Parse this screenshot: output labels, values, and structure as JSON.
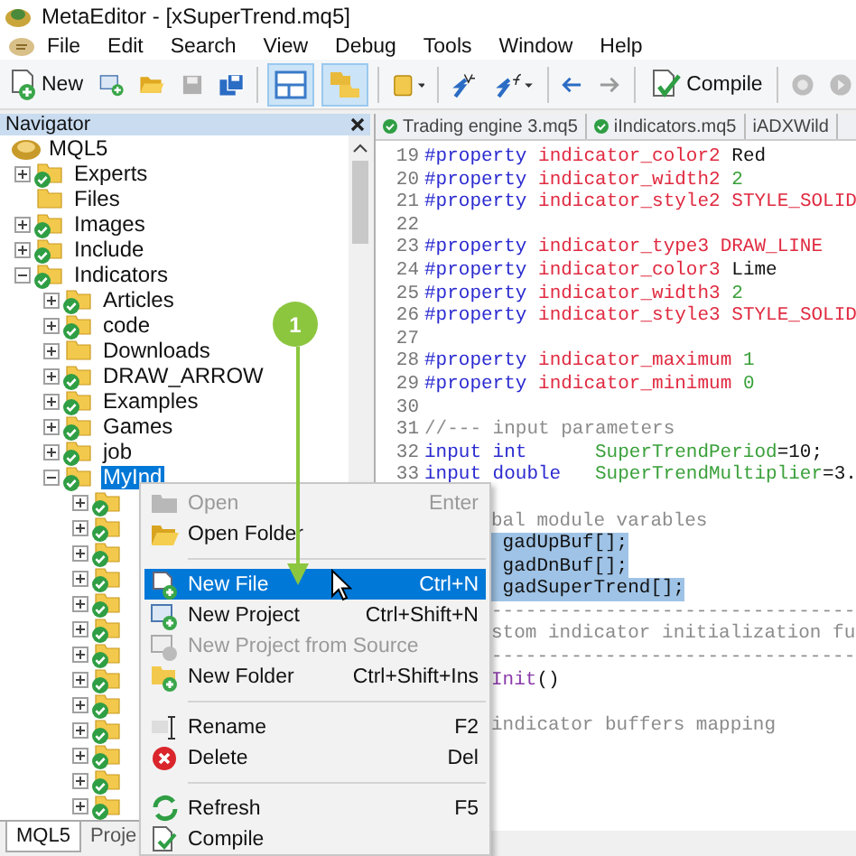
{
  "window": {
    "title": "MetaEditor - [xSuperTrend.mq5]"
  },
  "menu": [
    "File",
    "Edit",
    "Search",
    "View",
    "Debug",
    "Tools",
    "Window",
    "Help"
  ],
  "toolbar": {
    "new_button": {
      "label": "New"
    },
    "compile_button": {
      "label": "Compile"
    },
    "save_disabled": true,
    "view_toggles": [
      {
        "pressed": true
      },
      {
        "pressed": true
      }
    ]
  },
  "navigator": {
    "title": "Navigator",
    "root": {
      "label": "MQL5",
      "selected": false,
      "children": [
        {
          "label": "Experts",
          "selected": false,
          "expanded": false,
          "synced": true
        },
        {
          "label": "Files",
          "selected": false,
          "synced": false
        },
        {
          "label": "Images",
          "selected": false,
          "expanded": false,
          "synced": true
        },
        {
          "label": "Include",
          "selected": false,
          "expanded": false,
          "synced": true
        },
        {
          "label": "Indicators",
          "selected": false,
          "expanded": true,
          "synced": true,
          "children": [
            {
              "label": "Articles",
              "selected": false,
              "expanded": false,
              "synced": true
            },
            {
              "label": "code",
              "selected": false,
              "expanded": false,
              "synced": true
            },
            {
              "label": "Downloads",
              "selected": false,
              "expanded": false,
              "synced": false
            },
            {
              "label": "DRAW_ARROW",
              "selected": false,
              "expanded": false,
              "synced": true
            },
            {
              "label": "Examples",
              "selected": false,
              "expanded": false,
              "synced": true
            },
            {
              "label": "Games",
              "selected": false,
              "expanded": false,
              "synced": true
            },
            {
              "label": "job",
              "selected": false,
              "expanded": false,
              "synced": true
            },
            {
              "label": "MyInd",
              "selected": true,
              "expanded": true,
              "synced": true,
              "children": [
                {
                  "expanded": false,
                  "synced": true
                },
                {
                  "expanded": false,
                  "synced": true
                },
                {
                  "expanded": false,
                  "synced": true
                },
                {
                  "expanded": false,
                  "synced": true
                },
                {
                  "expanded": false,
                  "synced": true
                },
                {
                  "expanded": false,
                  "synced": true
                },
                {
                  "expanded": false,
                  "synced": true
                },
                {
                  "expanded": false,
                  "synced": true
                },
                {
                  "expanded": false,
                  "synced": true
                },
                {
                  "expanded": false,
                  "synced": true
                },
                {
                  "expanded": false,
                  "synced": true
                },
                {
                  "expanded": false,
                  "synced": true
                },
                {
                  "expanded": false,
                  "synced": true
                }
              ]
            }
          ]
        }
      ]
    }
  },
  "bottom_tabs": [
    {
      "label": "MQL5",
      "selected": true
    },
    {
      "label": "Proje",
      "selected": false
    }
  ],
  "editor_tabs": [
    {
      "label": "Trading engine 3.mq5",
      "synced": true
    },
    {
      "label": "iIndicators.mq5",
      "synced": true
    },
    {
      "label": "iADXWild",
      "synced": false
    }
  ],
  "code_lines": [
    {
      "kind": "full",
      "num": "19",
      "selected": false,
      "tokens": [
        {
          "text": "#property",
          "kind": "directive"
        },
        {
          "text": "indicator_color2",
          "kind": "property"
        },
        {
          "text": "Red",
          "kind": "plain"
        }
      ]
    },
    {
      "kind": "full",
      "num": "20",
      "selected": false,
      "tokens": [
        {
          "text": "#property",
          "kind": "directive"
        },
        {
          "text": "indicator_width2",
          "kind": "property"
        },
        {
          "text": "2",
          "kind": "number"
        }
      ]
    },
    {
      "kind": "full",
      "num": "21",
      "selected": false,
      "tokens": [
        {
          "text": "#property",
          "kind": "directive"
        },
        {
          "text": "indicator_style2",
          "kind": "property"
        },
        {
          "text": "STYLE_SOLID",
          "kind": "constant"
        }
      ]
    },
    {
      "kind": "full",
      "num": "22"
    },
    {
      "kind": "full",
      "num": "23",
      "selected": false,
      "tokens": [
        {
          "text": "#property",
          "kind": "directive"
        },
        {
          "text": "indicator_type3",
          "kind": "property"
        },
        {
          "text": "DRAW_LINE",
          "kind": "constant"
        }
      ]
    },
    {
      "kind": "full",
      "num": "24",
      "selected": false,
      "tokens": [
        {
          "text": "#property",
          "kind": "directive"
        },
        {
          "text": "indicator_color3",
          "kind": "property"
        },
        {
          "text": "Lime",
          "kind": "plain"
        }
      ]
    },
    {
      "kind": "full",
      "num": "25",
      "selected": false,
      "tokens": [
        {
          "text": "#property",
          "kind": "directive"
        },
        {
          "text": "indicator_width3",
          "kind": "property"
        },
        {
          "text": "2",
          "kind": "number"
        }
      ]
    },
    {
      "kind": "full",
      "num": "26",
      "selected": false,
      "tokens": [
        {
          "text": "#property",
          "kind": "directive"
        },
        {
          "text": "indicator_style3",
          "kind": "property"
        },
        {
          "text": "STYLE_SOLID",
          "kind": "constant"
        }
      ]
    },
    {
      "kind": "full",
      "num": "27"
    },
    {
      "kind": "full",
      "num": "28",
      "selected": false,
      "tokens": [
        {
          "text": "#property",
          "kind": "directive"
        },
        {
          "text": "indicator_maximum",
          "kind": "property"
        },
        {
          "text": "1",
          "kind": "number"
        }
      ]
    },
    {
      "kind": "full",
      "num": "29",
      "selected": false,
      "tokens": [
        {
          "text": "#property",
          "kind": "directive"
        },
        {
          "text": "indicator_minimum",
          "kind": "property"
        },
        {
          "text": "0",
          "kind": "number"
        }
      ]
    },
    {
      "kind": "full",
      "num": "30"
    },
    {
      "kind": "full",
      "num": "31",
      "selected": false,
      "tokens": [
        {
          "text": "//--- input parameters",
          "kind": "comment"
        }
      ]
    },
    {
      "kind": "full",
      "num": "32",
      "selected": false,
      "tokens": [
        {
          "text": "input int",
          "kind": "keyword"
        },
        {
          "text": "SuperTrendPeriod",
          "kind": "identifier"
        },
        {
          "text": "=10;",
          "kind": "operator"
        }
      ]
    },
    {
      "kind": "full",
      "num": "33",
      "selected": false,
      "tokens": [
        {
          "text": "input double",
          "kind": "keyword"
        },
        {
          "text": "SuperTrendMultiplier",
          "kind": "identifier"
        },
        {
          "text": "=3.",
          "kind": "operator"
        }
      ]
    },
    {
      "kind": "partial"
    },
    {
      "kind": "partial",
      "selected": false,
      "tokens": [
        {
          "text": "bal module varables",
          "kind": "comment"
        }
      ]
    },
    {
      "kind": "partial",
      "selected": true,
      "tokens": [
        {
          "text": "gadUpBuf[];",
          "kind": "plain"
        }
      ]
    },
    {
      "kind": "partial",
      "selected": true,
      "tokens": [
        {
          "text": "gadDnBuf[];",
          "kind": "plain"
        }
      ]
    },
    {
      "kind": "partial",
      "selected": true,
      "tokens": [
        {
          "text": "gadSuperTrend[];",
          "kind": "plain"
        }
      ]
    },
    {
      "kind": "partial",
      "selected": false,
      "tokens": [
        {
          "text": "--------------------------------",
          "kind": "comment"
        }
      ]
    },
    {
      "kind": "partial",
      "selected": false,
      "tokens": [
        {
          "text": "stom indicator initialization fu",
          "kind": "comment"
        }
      ]
    },
    {
      "kind": "partial",
      "selected": false,
      "tokens": [
        {
          "text": "--------------------------------",
          "kind": "comment"
        }
      ]
    },
    {
      "kind": "partial",
      "selected": false,
      "tokens": [
        {
          "text": "Init",
          "kind": "function"
        },
        {
          "text": "()",
          "kind": "operator"
        }
      ]
    },
    {
      "kind": "partial"
    },
    {
      "kind": "partial",
      "selected": false,
      "tokens": [
        {
          "text": "indicator buffers mapping",
          "kind": "comment"
        }
      ]
    }
  ],
  "context_menu": [
    {
      "kind": "item",
      "label": "Open",
      "shortcut": "Enter",
      "disabled": true,
      "selected": false
    },
    {
      "kind": "item",
      "label": "Open Folder",
      "disabled": false,
      "selected": false
    },
    {
      "kind": "separator"
    },
    {
      "kind": "item",
      "label": "New File",
      "shortcut": "Ctrl+N",
      "disabled": false,
      "selected": true
    },
    {
      "kind": "item",
      "label": "New Project",
      "shortcut": "Ctrl+Shift+N",
      "disabled": false,
      "selected": false
    },
    {
      "kind": "item",
      "label": "New Project from Source",
      "disabled": true,
      "selected": false
    },
    {
      "kind": "item",
      "label": "New Folder",
      "shortcut": "Ctrl+Shift+Ins",
      "disabled": false,
      "selected": false
    },
    {
      "kind": "separator"
    },
    {
      "kind": "item",
      "label": "Rename",
      "shortcut": "F2",
      "disabled": false,
      "selected": false
    },
    {
      "kind": "item",
      "label": "Delete",
      "shortcut": "Del",
      "disabled": false,
      "selected": false
    },
    {
      "kind": "separator"
    },
    {
      "kind": "item",
      "label": "Refresh",
      "shortcut": "F5",
      "disabled": false,
      "selected": false
    },
    {
      "kind": "item",
      "label": "Compile",
      "disabled": false,
      "selected": false
    }
  ],
  "annotation": {
    "step": "1"
  }
}
